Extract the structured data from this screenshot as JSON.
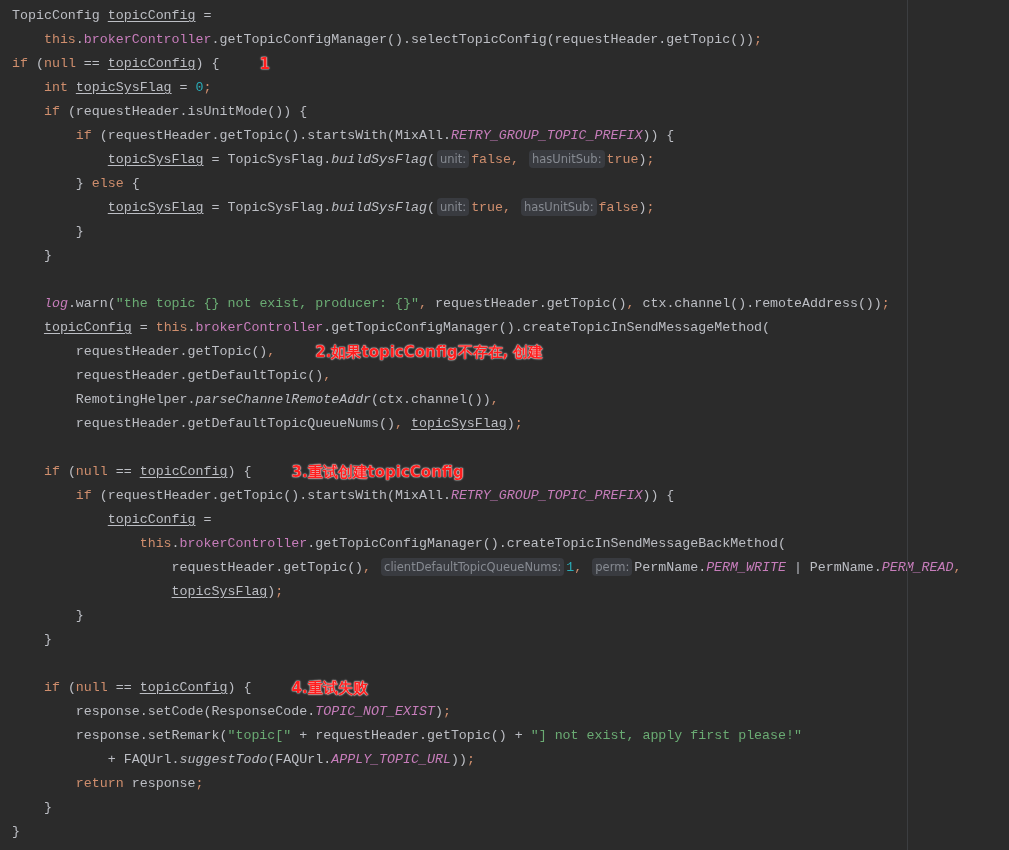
{
  "editor": {
    "lines": [
      {
        "kind": "code",
        "tokens": [
          {
            "kind": "plain",
            "text": "TopicConfig "
          },
          {
            "kind": "var",
            "text": "topicConfig"
          },
          {
            "kind": "plain",
            "text": " ="
          }
        ]
      },
      {
        "kind": "code",
        "tokens": [
          {
            "kind": "keyword",
            "text": "    this"
          },
          {
            "kind": "plain",
            "text": "."
          },
          {
            "kind": "field",
            "text": "brokerController"
          },
          {
            "kind": "plain",
            "text": ".getTopicConfigManager().selectTopicConfig(requestHeader.getTopic())"
          },
          {
            "kind": "keyword",
            "text": ";"
          }
        ]
      },
      {
        "kind": "code",
        "note": "1",
        "tokens": [
          {
            "kind": "keyword",
            "text": "if"
          },
          {
            "kind": "plain",
            "text": " ("
          },
          {
            "kind": "keyword",
            "text": "null"
          },
          {
            "kind": "plain",
            "text": " == "
          },
          {
            "kind": "var",
            "text": "topicConfig"
          },
          {
            "kind": "plain",
            "text": ") {"
          }
        ]
      },
      {
        "kind": "code",
        "tokens": [
          {
            "kind": "keyword",
            "text": "    int "
          },
          {
            "kind": "var",
            "text": "topicSysFlag"
          },
          {
            "kind": "plain",
            "text": " = "
          },
          {
            "kind": "number",
            "text": "0"
          },
          {
            "kind": "keyword",
            "text": ";"
          }
        ]
      },
      {
        "kind": "code",
        "tokens": [
          {
            "kind": "keyword",
            "text": "    if"
          },
          {
            "kind": "plain",
            "text": " (requestHeader.isUnitMode()) {"
          }
        ]
      },
      {
        "kind": "code",
        "tokens": [
          {
            "kind": "keyword",
            "text": "        if"
          },
          {
            "kind": "plain",
            "text": " (requestHeader.getTopic().startsWith(MixAll."
          },
          {
            "kind": "static",
            "text": "RETRY_GROUP_TOPIC_PREFIX"
          },
          {
            "kind": "plain",
            "text": ")) {"
          }
        ]
      },
      {
        "kind": "code",
        "tokens": [
          {
            "kind": "var",
            "text": "            topicSysFlag"
          },
          {
            "kind": "plain",
            "text": " = TopicSysFlag."
          },
          {
            "kind": "smethod",
            "text": "buildSysFlag"
          },
          {
            "kind": "plain",
            "text": "("
          },
          {
            "kind": "hint",
            "text": "unit:"
          },
          {
            "kind": "keyword",
            "text": "false"
          },
          {
            "kind": "keyword",
            "text": ", "
          },
          {
            "kind": "hint",
            "text": "hasUnitSub:"
          },
          {
            "kind": "keyword",
            "text": "true"
          },
          {
            "kind": "plain",
            "text": ")"
          },
          {
            "kind": "keyword",
            "text": ";"
          }
        ]
      },
      {
        "kind": "code",
        "tokens": [
          {
            "kind": "plain",
            "text": "        } "
          },
          {
            "kind": "keyword",
            "text": "else"
          },
          {
            "kind": "plain",
            "text": " {"
          }
        ]
      },
      {
        "kind": "code",
        "tokens": [
          {
            "kind": "var",
            "text": "            topicSysFlag"
          },
          {
            "kind": "plain",
            "text": " = TopicSysFlag."
          },
          {
            "kind": "smethod",
            "text": "buildSysFlag"
          },
          {
            "kind": "plain",
            "text": "("
          },
          {
            "kind": "hint",
            "text": "unit:"
          },
          {
            "kind": "keyword",
            "text": "true"
          },
          {
            "kind": "keyword",
            "text": ", "
          },
          {
            "kind": "hint",
            "text": "hasUnitSub:"
          },
          {
            "kind": "keyword",
            "text": "false"
          },
          {
            "kind": "plain",
            "text": ")"
          },
          {
            "kind": "keyword",
            "text": ";"
          }
        ]
      },
      {
        "kind": "code",
        "tokens": [
          {
            "kind": "plain",
            "text": "        }"
          }
        ]
      },
      {
        "kind": "code",
        "tokens": [
          {
            "kind": "plain",
            "text": "    }"
          }
        ]
      },
      {
        "kind": "blank"
      },
      {
        "kind": "code",
        "tokens": [
          {
            "kind": "static",
            "text": "    log"
          },
          {
            "kind": "plain",
            "text": ".warn("
          },
          {
            "kind": "string",
            "text": "\"the topic {} not exist, producer: {}\""
          },
          {
            "kind": "keyword",
            "text": ","
          },
          {
            "kind": "plain",
            "text": " requestHeader.getTopic()"
          },
          {
            "kind": "keyword",
            "text": ","
          },
          {
            "kind": "plain",
            "text": " ctx.channel().remoteAddress())"
          },
          {
            "kind": "keyword",
            "text": ";"
          }
        ]
      },
      {
        "kind": "code",
        "tokens": [
          {
            "kind": "var",
            "text": "    topicConfig"
          },
          {
            "kind": "plain",
            "text": " = "
          },
          {
            "kind": "keyword",
            "text": "this"
          },
          {
            "kind": "plain",
            "text": "."
          },
          {
            "kind": "field",
            "text": "brokerController"
          },
          {
            "kind": "plain",
            "text": ".getTopicConfigManager().createTopicInSendMessageMethod("
          }
        ]
      },
      {
        "kind": "code",
        "note": "2.如果topicConfig不存在, 创建",
        "tokens": [
          {
            "kind": "plain",
            "text": "        requestHeader.getTopic()"
          },
          {
            "kind": "keyword",
            "text": ","
          }
        ]
      },
      {
        "kind": "code",
        "tokens": [
          {
            "kind": "plain",
            "text": "        requestHeader.getDefaultTopic()"
          },
          {
            "kind": "keyword",
            "text": ","
          }
        ]
      },
      {
        "kind": "code",
        "tokens": [
          {
            "kind": "plain",
            "text": "        RemotingHelper."
          },
          {
            "kind": "smethod",
            "text": "parseChannelRemoteAddr"
          },
          {
            "kind": "plain",
            "text": "(ctx.channel())"
          },
          {
            "kind": "keyword",
            "text": ","
          }
        ]
      },
      {
        "kind": "code",
        "tokens": [
          {
            "kind": "plain",
            "text": "        requestHeader.getDefaultTopicQueueNums()"
          },
          {
            "kind": "keyword",
            "text": ", "
          },
          {
            "kind": "var",
            "text": "topicSysFlag"
          },
          {
            "kind": "plain",
            "text": ")"
          },
          {
            "kind": "keyword",
            "text": ";"
          }
        ]
      },
      {
        "kind": "blank"
      },
      {
        "kind": "code",
        "note": "3.重试创建topicConfig",
        "tokens": [
          {
            "kind": "keyword",
            "text": "    if"
          },
          {
            "kind": "plain",
            "text": " ("
          },
          {
            "kind": "keyword",
            "text": "null"
          },
          {
            "kind": "plain",
            "text": " == "
          },
          {
            "kind": "var",
            "text": "topicConfig"
          },
          {
            "kind": "plain",
            "text": ") {"
          }
        ]
      },
      {
        "kind": "code",
        "tokens": [
          {
            "kind": "keyword",
            "text": "        if"
          },
          {
            "kind": "plain",
            "text": " (requestHeader.getTopic().startsWith(MixAll."
          },
          {
            "kind": "static",
            "text": "RETRY_GROUP_TOPIC_PREFIX"
          },
          {
            "kind": "plain",
            "text": ")) {"
          }
        ]
      },
      {
        "kind": "code",
        "tokens": [
          {
            "kind": "var",
            "text": "            topicConfig"
          },
          {
            "kind": "plain",
            "text": " ="
          }
        ]
      },
      {
        "kind": "code",
        "tokens": [
          {
            "kind": "keyword",
            "text": "                this"
          },
          {
            "kind": "plain",
            "text": "."
          },
          {
            "kind": "field",
            "text": "brokerController"
          },
          {
            "kind": "plain",
            "text": ".getTopicConfigManager().createTopicInSendMessageBackMethod("
          }
        ]
      },
      {
        "kind": "code",
        "tokens": [
          {
            "kind": "plain",
            "text": "                    requestHeader.getTopic()"
          },
          {
            "kind": "keyword",
            "text": ", "
          },
          {
            "kind": "hint",
            "text": "clientDefaultTopicQueueNums:"
          },
          {
            "kind": "number",
            "text": "1"
          },
          {
            "kind": "keyword",
            "text": ", "
          },
          {
            "kind": "hint",
            "text": "perm:"
          },
          {
            "kind": "plain",
            "text": "PermName."
          },
          {
            "kind": "static",
            "text": "PERM_WRITE"
          },
          {
            "kind": "plain",
            "text": " | PermName."
          },
          {
            "kind": "static",
            "text": "PERM_READ"
          },
          {
            "kind": "keyword",
            "text": ","
          }
        ]
      },
      {
        "kind": "code",
        "tokens": [
          {
            "kind": "var",
            "text": "                    topicSysFlag"
          },
          {
            "kind": "plain",
            "text": ")"
          },
          {
            "kind": "keyword",
            "text": ";"
          }
        ]
      },
      {
        "kind": "code",
        "tokens": [
          {
            "kind": "plain",
            "text": "        }"
          }
        ]
      },
      {
        "kind": "code",
        "tokens": [
          {
            "kind": "plain",
            "text": "    }"
          }
        ]
      },
      {
        "kind": "blank"
      },
      {
        "kind": "code",
        "note": "4.重试失败",
        "tokens": [
          {
            "kind": "keyword",
            "text": "    if"
          },
          {
            "kind": "plain",
            "text": " ("
          },
          {
            "kind": "keyword",
            "text": "null"
          },
          {
            "kind": "plain",
            "text": " == "
          },
          {
            "kind": "var",
            "text": "topicConfig"
          },
          {
            "kind": "plain",
            "text": ") {"
          }
        ]
      },
      {
        "kind": "code",
        "tokens": [
          {
            "kind": "plain",
            "text": "        response.setCode(ResponseCode."
          },
          {
            "kind": "static",
            "text": "TOPIC_NOT_EXIST"
          },
          {
            "kind": "plain",
            "text": ")"
          },
          {
            "kind": "keyword",
            "text": ";"
          }
        ]
      },
      {
        "kind": "code",
        "tokens": [
          {
            "kind": "plain",
            "text": "        response.setRemark("
          },
          {
            "kind": "string",
            "text": "\"topic[\""
          },
          {
            "kind": "plain",
            "text": " + requestHeader.getTopic() + "
          },
          {
            "kind": "string",
            "text": "\"] not exist, apply first please!\""
          }
        ]
      },
      {
        "kind": "code",
        "tokens": [
          {
            "kind": "plain",
            "text": "            + FAQUrl."
          },
          {
            "kind": "smethod",
            "text": "suggestTodo"
          },
          {
            "kind": "plain",
            "text": "(FAQUrl."
          },
          {
            "kind": "static",
            "text": "APPLY_TOPIC_URL"
          },
          {
            "kind": "plain",
            "text": "))"
          },
          {
            "kind": "keyword",
            "text": ";"
          }
        ]
      },
      {
        "kind": "code",
        "tokens": [
          {
            "kind": "keyword",
            "text": "        return"
          },
          {
            "kind": "plain",
            "text": " response"
          },
          {
            "kind": "keyword",
            "text": ";"
          }
        ]
      },
      {
        "kind": "code",
        "tokens": [
          {
            "kind": "plain",
            "text": "    }"
          }
        ]
      },
      {
        "kind": "code",
        "tokens": [
          {
            "kind": "plain",
            "text": "}"
          }
        ]
      }
    ]
  }
}
